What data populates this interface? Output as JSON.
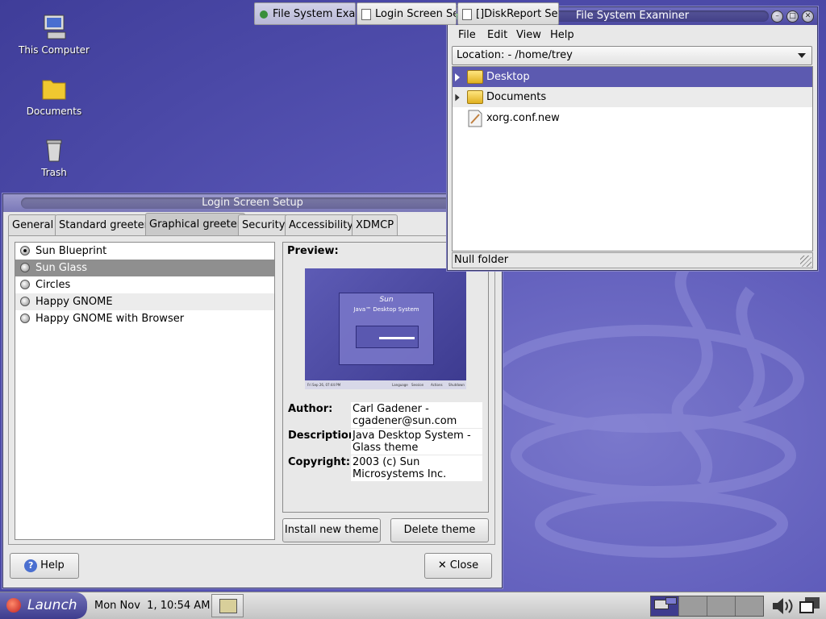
{
  "desktop": {
    "icons": [
      {
        "label": "This Computer",
        "icon": "computer-icon"
      },
      {
        "label": "Documents",
        "icon": "folder-icon"
      },
      {
        "label": "Trash",
        "icon": "trash-icon"
      }
    ]
  },
  "login_setup": {
    "title": "Login Screen Setup",
    "tabs": [
      "General",
      "Standard greeter",
      "Graphical greeter",
      "Security",
      "Accessibility",
      "XDMCP"
    ],
    "active_tab": "Graphical greeter",
    "themes": [
      {
        "name": "Sun Blueprint",
        "checked": true
      },
      {
        "name": "Sun Glass",
        "selected": true
      },
      {
        "name": "Circles"
      },
      {
        "name": "Happy GNOME"
      },
      {
        "name": "Happy GNOME with Browser"
      }
    ],
    "preview_label": "Preview:",
    "preview_image": {
      "logo": "Sun",
      "heading": "Java™ Desktop System",
      "footer_time": "Fri Sep 26, 07:44 PM",
      "footer_items": [
        "Language",
        "Session",
        "Actions",
        "Shutdown"
      ]
    },
    "author_label": "Author:",
    "author": "Carl Gadener - cgadener@sun.com",
    "description_label": "Description:",
    "description": "Java Desktop System - Glass theme",
    "copyright_label": "Copyright:",
    "copyright": "2003 (c) Sun Microsystems Inc.",
    "install_button": "Install new theme",
    "delete_button": "Delete theme",
    "help_button": "Help",
    "close_button": "Close"
  },
  "fs_examiner": {
    "title": "File System Examiner",
    "menu": [
      "File",
      "Edit",
      "View",
      "Help"
    ],
    "location": "Location: - /home/trey",
    "rows": [
      {
        "name": "Desktop",
        "type": "folder",
        "selected": true
      },
      {
        "name": "Documents",
        "type": "folder"
      },
      {
        "name": "xorg.conf.new",
        "type": "file"
      }
    ],
    "status": "Null folder"
  },
  "panel": {
    "launch_label": "Launch",
    "clock": "Mon Nov  1, 10:54 AM",
    "tasks": [
      {
        "label": "File System Exami",
        "active": true
      },
      {
        "label": "Login Screen Se"
      },
      {
        "label": "[]DiskReport Set"
      }
    ],
    "workspace_count": 4
  },
  "colors": {
    "desktop": "#4e4ca8",
    "title_active": "#4b48a0",
    "selection": "#5c5ab0"
  }
}
